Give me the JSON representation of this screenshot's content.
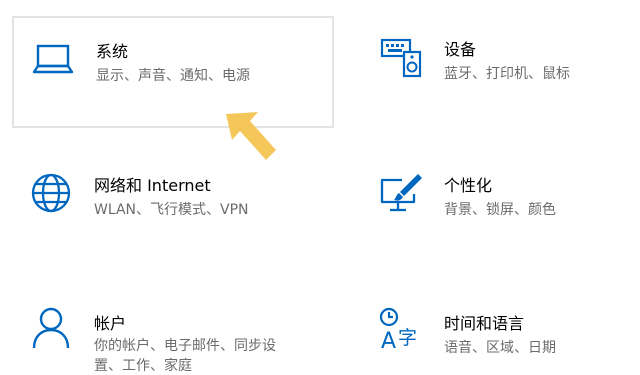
{
  "colors": {
    "accent": "#0067c0",
    "title": "#000000",
    "desc": "#6b6b6b",
    "arrow": "#f5c75a",
    "selected_border": "#e3e3e3"
  },
  "tiles": [
    {
      "icon": "laptop-icon",
      "title": "系统",
      "desc": "显示、声音、通知、电源"
    },
    {
      "icon": "keyboard-speaker-icon",
      "title": "设备",
      "desc": "蓝牙、打印机、鼠标"
    },
    {
      "icon": "globe-icon",
      "title": "网络和 Internet",
      "desc": "WLAN、飞行模式、VPN"
    },
    {
      "icon": "paint-brush-monitor-icon",
      "title": "个性化",
      "desc": "背景、锁屏、颜色"
    },
    {
      "icon": "person-icon",
      "title": "帐户",
      "desc_line1": "你的帐户、电子邮件、同步设",
      "desc_line2": "置、工作、家庭"
    },
    {
      "icon": "language-icon",
      "title": "时间和语言",
      "desc": "语音、区域、日期"
    }
  ]
}
